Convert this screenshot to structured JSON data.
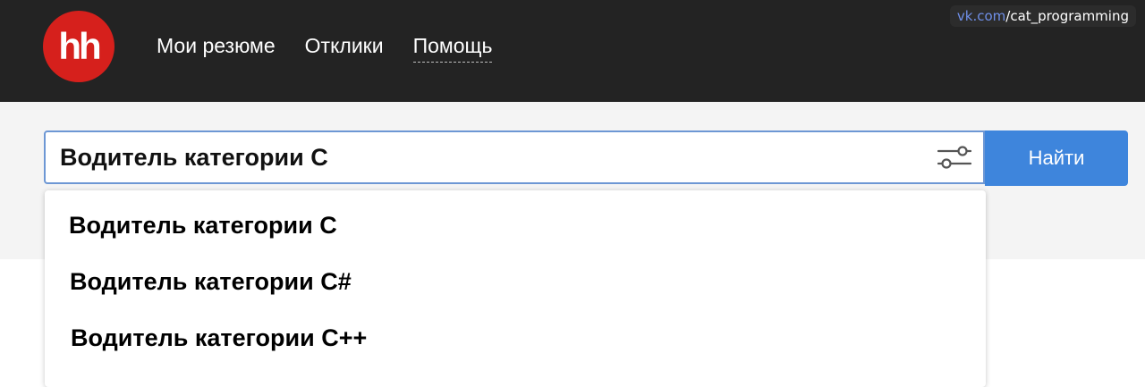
{
  "header": {
    "logo_text": "hh",
    "nav": [
      {
        "label": "Мои резюме"
      },
      {
        "label": "Отклики"
      },
      {
        "label": "Помощь"
      }
    ],
    "watermark": {
      "domain": "vk.com",
      "path": "/cat_programming"
    }
  },
  "search": {
    "value": "Водитель категории С",
    "button_label": "Найти",
    "suggestions": [
      {
        "label": "Водитель категории С"
      },
      {
        "label": "Водитель категории C#"
      },
      {
        "label": "Водитель категории C++"
      }
    ]
  },
  "colors": {
    "header_bg": "#232323",
    "logo_red": "#d6201c",
    "button_blue": "#3e85dc",
    "input_border": "#6d97d4"
  },
  "icons": {
    "filter": "sliders-icon"
  }
}
